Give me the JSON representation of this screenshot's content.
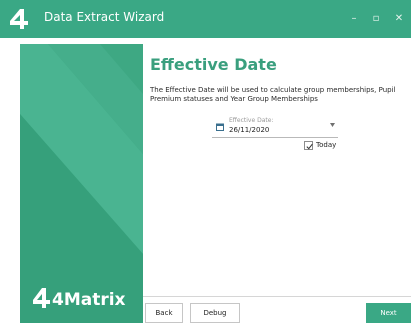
{
  "window": {
    "title": "Data Extract Wizard",
    "controls": {
      "minimize": "–",
      "maximize": "▫",
      "close": "✕"
    }
  },
  "sidebar": {
    "brand": "4Matrix"
  },
  "main": {
    "heading": "Effective Date",
    "description": "The Effective Date will be used to calculate group memberships, Pupil Premium statuses and Year Group Memberships",
    "date_field": {
      "label": "Effective Date:",
      "value": "26/11/2020"
    },
    "today_checkbox": {
      "label": "Today",
      "checked": true
    }
  },
  "footer": {
    "back_label": "Back",
    "debug_label": "Debug",
    "next_label": "Next"
  },
  "colors": {
    "accent": "#3aa885",
    "heading": "#3a9f7e",
    "sidebar": "#3ea883"
  }
}
